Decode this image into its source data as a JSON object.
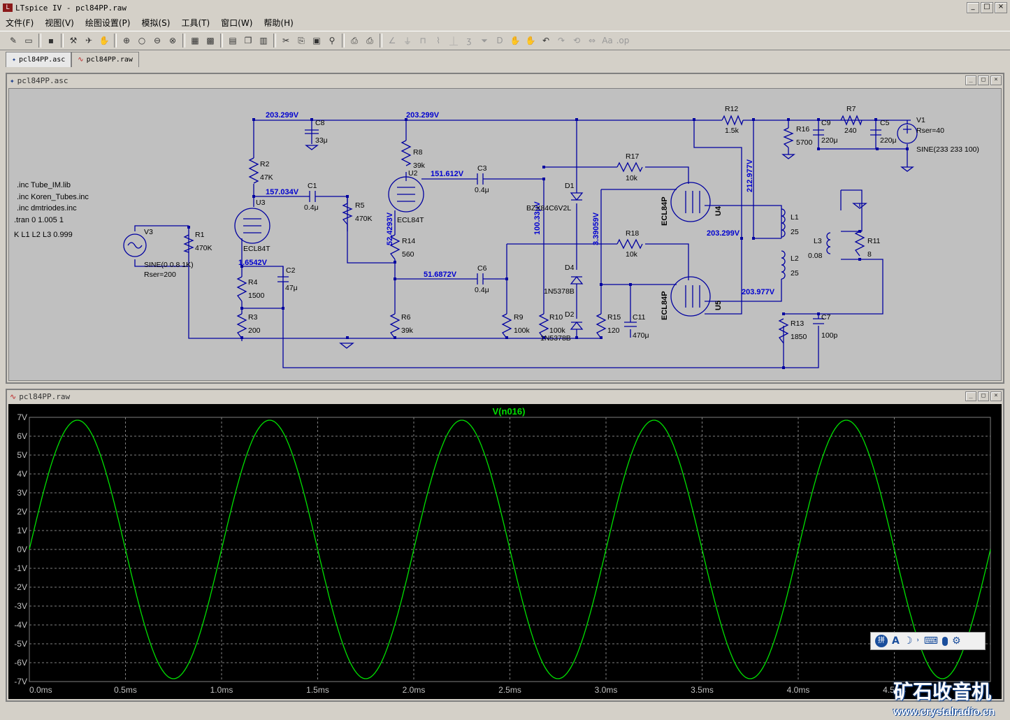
{
  "window": {
    "title": "LTspice IV - pcl84PP.raw",
    "minimize": "_",
    "maximize": "□",
    "close": "×"
  },
  "menu": [
    "文件(F)",
    "视图(V)",
    "绘图设置(P)",
    "模拟(S)",
    "工具(T)",
    "窗口(W)",
    "帮助(H)"
  ],
  "tabs": [
    {
      "label": "pcl84PP.asc"
    },
    {
      "label": "pcl84PP.raw"
    }
  ],
  "schematic": {
    "title": "pcl84PP.asc",
    "directives": [
      ".inc Tube_IM.lib",
      ".inc Koren_Tubes.inc",
      ".inc dmtriodes.inc",
      ".tran 0 1.005 1",
      "K L1 L2 L3 0.999"
    ],
    "voltages": {
      "v1": "203.299V",
      "v2": "203.299V",
      "v3": "157.034V",
      "v4": "151.612V",
      "v5": "52.4293V",
      "v6": "1.6542V",
      "v7": "51.6872V",
      "v8": "100.33μV",
      "v9": "3.39059V",
      "v10": "212.977V",
      "v11": "203.299V",
      "v12": "203.977V"
    },
    "components": {
      "R1": [
        "R1",
        "470K"
      ],
      "R2": [
        "R2",
        "47K"
      ],
      "R3": [
        "R3",
        "200"
      ],
      "R4": [
        "R4",
        "1500"
      ],
      "R5": [
        "R5",
        "470K"
      ],
      "R6": [
        "R6",
        "39k"
      ],
      "R8": [
        "R8",
        "39k"
      ],
      "R14": [
        "R14",
        "560"
      ],
      "R9": [
        "R9",
        "100k"
      ],
      "R10": [
        "R10",
        "100k"
      ],
      "R15": [
        "R15",
        "120"
      ],
      "R17": [
        "R17",
        "10k"
      ],
      "R18": [
        "R18",
        "10k"
      ],
      "R12": [
        "R12",
        "1.5k"
      ],
      "R16": [
        "R16",
        "5700"
      ],
      "R7": [
        "R7",
        "240"
      ],
      "R11": [
        "R11",
        "8"
      ],
      "R13": [
        "R13",
        "1850"
      ],
      "C1": [
        "C1",
        "0.4μ"
      ],
      "C2": [
        "C2",
        "47μ"
      ],
      "C3": [
        "C3",
        "0.4μ"
      ],
      "C6": [
        "C6",
        "0.4μ"
      ],
      "C8": [
        "C8",
        "33μ"
      ],
      "C9": [
        "C9",
        "220μ"
      ],
      "C5": [
        "C5",
        "220μ"
      ],
      "C11": [
        "C11",
        "470μ"
      ],
      "C7": [
        "C7",
        "100p"
      ],
      "L1": [
        "L1",
        "25"
      ],
      "L2": [
        "L2",
        "25"
      ],
      "L3": [
        "L3",
        "0.08"
      ],
      "D1": "D1",
      "D2": "D2",
      "D4": "D4",
      "dz_model": "BZX84C6V2L",
      "d_model1": "1N5378B",
      "d_model2": "1N5378B",
      "U2": [
        "U2",
        "ECL84T"
      ],
      "U3": [
        "U3",
        "ECL84T"
      ],
      "U4": [
        "U4",
        "ECL84P"
      ],
      "U5": [
        "U5",
        "ECL84P"
      ],
      "V1": [
        "V1",
        "Rser=40",
        "SINE(233 233 100)"
      ],
      "V3": [
        "V3",
        "SINE(0 0.8 1K)",
        "Rser=200"
      ]
    }
  },
  "waveform": {
    "title": "pcl84PP.raw",
    "trace": "V(n016)",
    "trace_color": "#00e000"
  },
  "chart_data": {
    "type": "line",
    "title": "",
    "series": [
      {
        "name": "V(n016)",
        "function": "sine",
        "amplitude": 6.85,
        "frequency_hz": 1000,
        "offset": 0
      }
    ],
    "x_unit": "ms",
    "xlim": [
      0.0,
      5.0
    ],
    "ylim": [
      -7,
      7
    ],
    "x_ticks": [
      "0.0ms",
      "0.5ms",
      "1.0ms",
      "1.5ms",
      "2.0ms",
      "2.5ms",
      "3.0ms",
      "3.5ms",
      "4.0ms",
      "4.5ms"
    ],
    "y_ticks": [
      "7V",
      "6V",
      "5V",
      "4V",
      "3V",
      "2V",
      "1V",
      "0V",
      "-1V",
      "-2V",
      "-3V",
      "-4V",
      "-5V",
      "-6V",
      "-7V"
    ],
    "grid": true
  },
  "watermark": {
    "cn": "矿石收音机",
    "url": "www.crystalradio.cn"
  },
  "ime": {
    "letter": "A",
    "moon": "☽",
    "comma": "˒",
    "keyboard": "⌨",
    "mic": "🎤",
    "gear": "⚙"
  }
}
